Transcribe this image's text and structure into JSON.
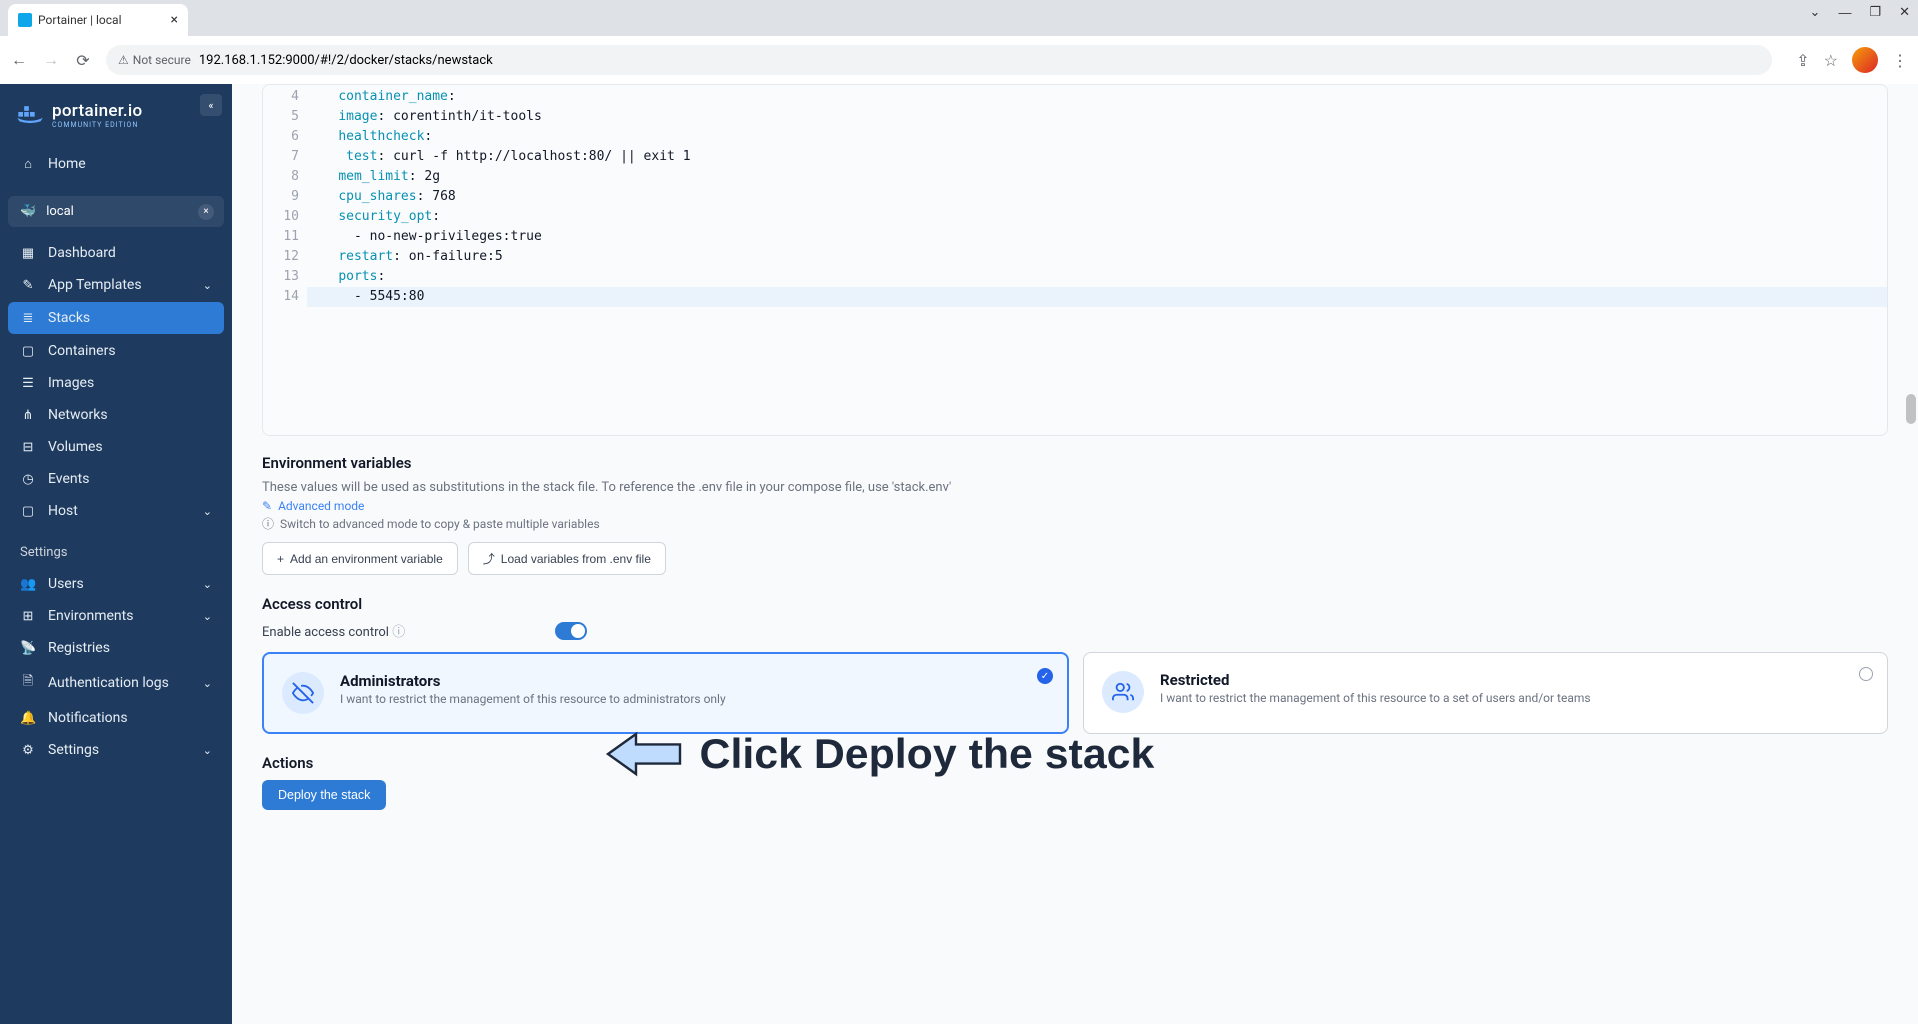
{
  "browser": {
    "tab_title": "Portainer | local",
    "not_secure_label": "Not secure",
    "url": "192.168.1.152:9000/#!/2/docker/stacks/newstack"
  },
  "logo": {
    "main": "portainer.io",
    "sub": "COMMUNITY EDITION"
  },
  "sidebar": {
    "home": "Home",
    "env_label": "local",
    "items": [
      {
        "label": "Dashboard"
      },
      {
        "label": "App Templates",
        "expandable": true
      },
      {
        "label": "Stacks",
        "active": true
      },
      {
        "label": "Containers"
      },
      {
        "label": "Images"
      },
      {
        "label": "Networks"
      },
      {
        "label": "Volumes"
      },
      {
        "label": "Events"
      },
      {
        "label": "Host",
        "expandable": true
      }
    ],
    "settings_header": "Settings",
    "settings_items": [
      {
        "label": "Users",
        "expandable": true
      },
      {
        "label": "Environments",
        "expandable": true
      },
      {
        "label": "Registries"
      },
      {
        "label": "Authentication logs",
        "expandable": true
      },
      {
        "label": "Notifications"
      },
      {
        "label": "Settings",
        "expandable": true
      }
    ]
  },
  "code": {
    "lines": [
      {
        "n": 4,
        "indent": "    ",
        "pre": "",
        "key": "container_name",
        "rest": ": "
      },
      {
        "n": 5,
        "indent": "    ",
        "key": "image",
        "rest": ": corentinth/it-tools"
      },
      {
        "n": 6,
        "indent": "    ",
        "key": "healthcheck",
        "rest": ":"
      },
      {
        "n": 7,
        "indent": "     ",
        "key": "test",
        "rest": ": curl -f http://localhost:80/ || exit 1"
      },
      {
        "n": 8,
        "indent": "    ",
        "key": "mem_limit",
        "rest": ": 2g"
      },
      {
        "n": 9,
        "indent": "    ",
        "key": "cpu_shares",
        "rest": ": 768"
      },
      {
        "n": 10,
        "indent": "    ",
        "key": "security_opt",
        "rest": ":"
      },
      {
        "n": 11,
        "indent": "      ",
        "key": "",
        "rest": "- no-new-privileges:true"
      },
      {
        "n": 12,
        "indent": "    ",
        "key": "restart",
        "rest": ": on-failure:5"
      },
      {
        "n": 13,
        "indent": "    ",
        "key": "ports",
        "rest": ":"
      },
      {
        "n": 14,
        "indent": "      ",
        "key": "",
        "rest": "- 5545:80",
        "current": true
      }
    ]
  },
  "env_section": {
    "title": "Environment variables",
    "help": "These values will be used as substitutions in the stack file. To reference the .env file in your compose file, use 'stack.env'",
    "advanced_link": "Advanced mode",
    "advanced_tip": "Switch to advanced mode to copy & paste multiple variables",
    "btn_add": "Add an environment variable",
    "btn_load": "Load variables from .env file"
  },
  "access_section": {
    "title": "Access control",
    "enable_label": "Enable access control",
    "cards": {
      "admin": {
        "title": "Administrators",
        "desc": "I want to restrict the management of this resource to administrators only"
      },
      "restricted": {
        "title": "Restricted",
        "desc": "I want to restrict the management of this resource to a set of users and/or teams"
      }
    }
  },
  "actions_section": {
    "title": "Actions",
    "deploy_btn": "Deploy the stack"
  },
  "annotation": {
    "text": "Click Deploy the stack"
  }
}
